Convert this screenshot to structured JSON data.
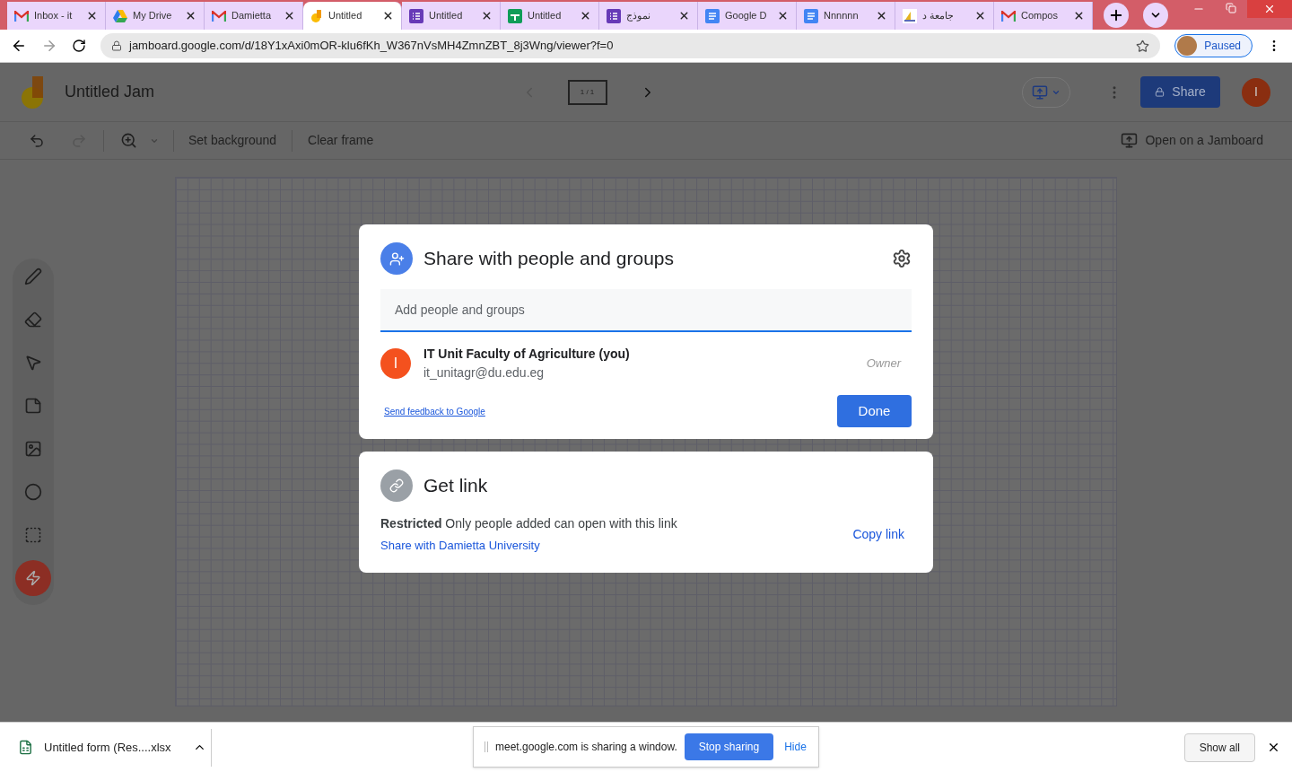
{
  "browser": {
    "tabs": [
      {
        "title": "Inbox - it",
        "kind": "gmail",
        "selected": false
      },
      {
        "title": "My Drive",
        "kind": "drive",
        "selected": false
      },
      {
        "title": "Damietta",
        "kind": "gmail",
        "selected": false
      },
      {
        "title": "Untitled",
        "kind": "jamboard",
        "selected": true
      },
      {
        "title": "Untitled",
        "kind": "forms",
        "selected": false
      },
      {
        "title": "Untitled",
        "kind": "sheets",
        "selected": false
      },
      {
        "title": "نموذج",
        "kind": "forms",
        "selected": false
      },
      {
        "title": "Google D",
        "kind": "docs",
        "selected": false
      },
      {
        "title": "Nnnnnn",
        "kind": "docs",
        "selected": false
      },
      {
        "title": "جامعة د",
        "kind": "site",
        "selected": false
      },
      {
        "title": "Compos",
        "kind": "gmail",
        "selected": false
      }
    ],
    "url": "jamboard.google.com/d/18Y1xAxi0mOR-klu6fKh_W367nVsMH4ZmnZBT_8j3Wng/viewer?f=0",
    "profile": "Paused"
  },
  "app": {
    "title": "Untitled Jam",
    "frame_counter": "1 / 1",
    "share_button": "Share",
    "avatar": "I"
  },
  "toolbar": {
    "items": [
      "Set background",
      "Clear frame"
    ],
    "open_on_jamboard": "Open on a Jamboard"
  },
  "share_dialog": {
    "title": "Share with people and groups",
    "input": {
      "placeholder": "Add people and groups"
    },
    "people": [
      {
        "initial": "I",
        "name": "IT Unit Faculty of Agriculture (you)",
        "email": "it_unitagr@du.edu.eg",
        "role": "Owner"
      }
    ],
    "feedback_link": "Send feedback to Google",
    "done": "Done"
  },
  "link_card": {
    "title": "Get link",
    "description": "**Restricted** Only people added can open with this link",
    "change_link": "Share with Damietta University",
    "copy": "Copy link"
  },
  "download": {
    "file": "Untitled form (Res....xlsx"
  },
  "sharing_bar": {
    "message": "meet.google.com is sharing a window.",
    "stop": "Stop sharing",
    "hide": "Hide"
  },
  "show_all": "Show all"
}
